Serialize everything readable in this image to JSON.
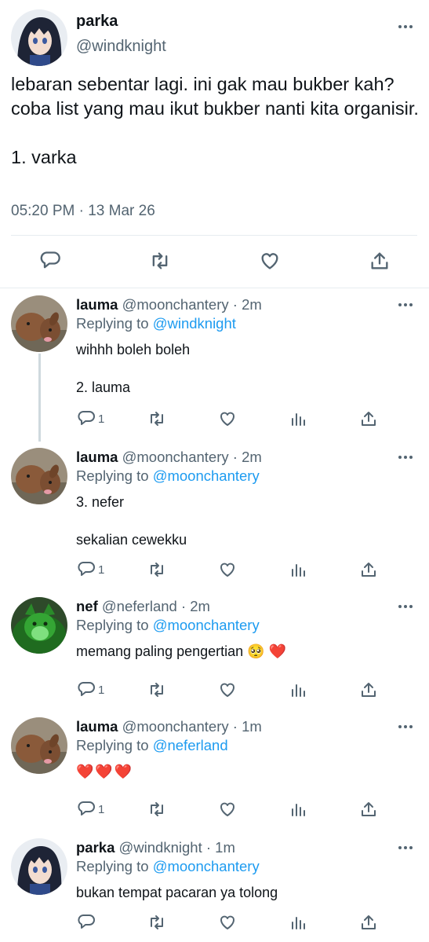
{
  "main_tweet": {
    "name": "parka",
    "handle": "@windknight",
    "text": "lebaran sebentar lagi. ini gak mau bukber kah? coba list yang mau ikut bukber nanti kita organisir.\n\n1. varka",
    "timestamp": "05:20 PM · 13 Mar 26"
  },
  "replies": [
    {
      "name": "lauma",
      "handle": "@moonchantery",
      "time": "· 2m",
      "replying_prefix": "Replying to",
      "replying_to": "@windknight",
      "text": "wihhh boleh boleh\n\n2. lauma",
      "reply_count": "1",
      "avatar": "deer"
    },
    {
      "name": "lauma",
      "handle": "@moonchantery",
      "time": "· 2m",
      "replying_prefix": "Replying to",
      "replying_to": "@moonchantery",
      "text": "3. nefer\n\nsekalian cewekku",
      "reply_count": "1",
      "avatar": "deer"
    },
    {
      "name": "nef",
      "handle": "@neferland",
      "time": "· 2m",
      "replying_prefix": "Replying to",
      "replying_to": "@moonchantery",
      "text": "memang paling pengertian 🥺 ❤️",
      "reply_count": "1",
      "avatar": "cat"
    },
    {
      "name": "lauma",
      "handle": "@moonchantery",
      "time": "· 1m",
      "replying_prefix": "Replying to",
      "replying_to": "@neferland",
      "text": "❤️❤️❤️",
      "reply_count": "1",
      "avatar": "deer"
    },
    {
      "name": "parka",
      "handle": "@windknight",
      "time": "· 1m",
      "replying_prefix": "Replying to",
      "replying_to": "@moonchantery",
      "text": "bukan tempat pacaran ya tolong",
      "reply_count": "",
      "avatar": "anime"
    }
  ],
  "icons": {
    "more": "more-icon",
    "reply": "reply-icon",
    "retweet": "retweet-icon",
    "like": "like-icon",
    "views": "views-icon",
    "share": "share-icon"
  },
  "colors": {
    "link": "#1d9bf0",
    "muted": "#536471",
    "heart": "#e0245e"
  }
}
